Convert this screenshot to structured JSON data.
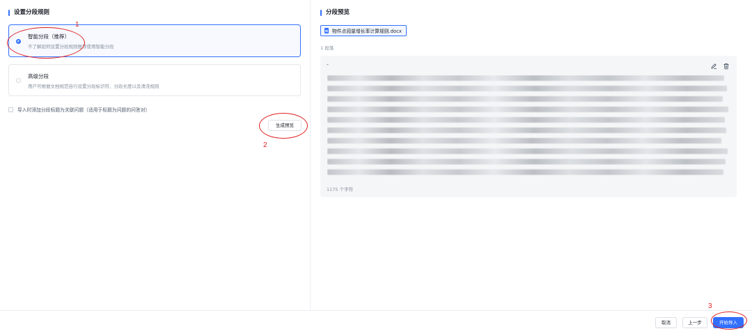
{
  "left_panel": {
    "title": "设置分段规则",
    "smart_option": {
      "title": "智能分段（推荐）",
      "desc": "不了解如何设置分段规则推荐使用智能分段",
      "selected": true
    },
    "advanced_option": {
      "title": "高级分段",
      "desc": "用户可根据文档规范自行设置分段标识符、分段长度以及清洗规则",
      "selected": false
    },
    "checkbox_label": "导入时添加分段标题为关联问题（适用于标题为问题的问答对）",
    "checkbox_checked": false,
    "preview_button": "生成预览"
  },
  "right_panel": {
    "title": "分段预览",
    "file_name": "物件点阅量增长率计算规则.docx",
    "segment_count": "1 段落",
    "segment": {
      "heading": "-",
      "char_count": "1175 个字符"
    }
  },
  "footer": {
    "cancel_label": "取消",
    "prev_label": "上一步",
    "start_label": "开始导入"
  },
  "annotations": {
    "step1": "1",
    "step2": "2",
    "step3": "3"
  },
  "colors": {
    "primary": "#3370ff",
    "annotation": "#e02020"
  }
}
